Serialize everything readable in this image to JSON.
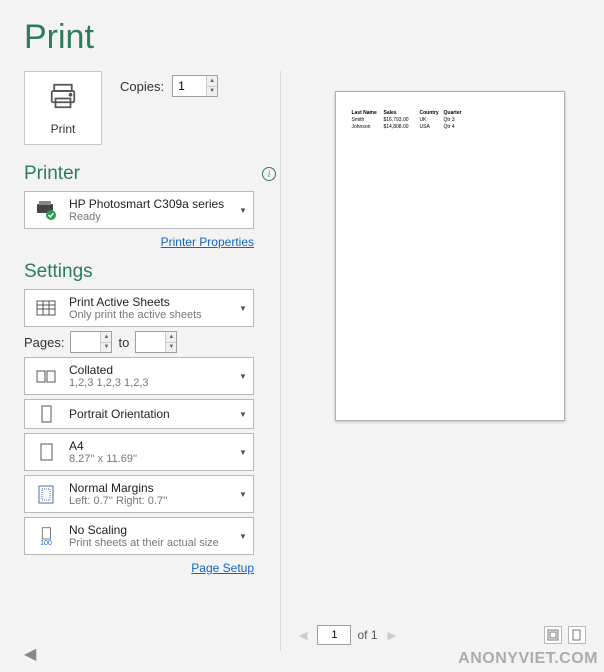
{
  "title": "Print",
  "print_button_label": "Print",
  "copies": {
    "label": "Copies:",
    "value": "1"
  },
  "printer_section": {
    "title": "Printer",
    "device": {
      "name": "HP Photosmart C309a series",
      "status": "Ready"
    },
    "properties_link": "Printer Properties"
  },
  "settings_section": {
    "title": "Settings",
    "active_sheets": {
      "primary": "Print Active Sheets",
      "secondary": "Only print the active sheets"
    },
    "pages": {
      "label": "Pages:",
      "from": "",
      "to_label": "to",
      "to": ""
    },
    "collated": {
      "primary": "Collated",
      "secondary": "1,2,3    1,2,3    1,2,3"
    },
    "orientation": {
      "primary": "Portrait Orientation"
    },
    "paper": {
      "primary": "A4",
      "secondary": "8.27'' x 11.69''"
    },
    "margins": {
      "primary": "Normal Margins",
      "secondary": "Left:  0.7''    Right:  0.7''"
    },
    "scaling": {
      "primary": "No Scaling",
      "secondary": "Print sheets at their actual size",
      "badge": "100"
    },
    "page_setup_link": "Page Setup"
  },
  "preview": {
    "headers": [
      "Last Name",
      "Sales",
      "Country",
      "Quarter"
    ],
    "rows": [
      [
        "Smith",
        "$16,793.00",
        "UK",
        "Qtr 3"
      ],
      [
        "Johnson",
        "$14,808.00",
        "USA",
        "Qtr 4"
      ]
    ]
  },
  "nav": {
    "current_page": "1",
    "of_label": "of",
    "total_pages": "1"
  },
  "watermark": "ANONYVIET.COM"
}
